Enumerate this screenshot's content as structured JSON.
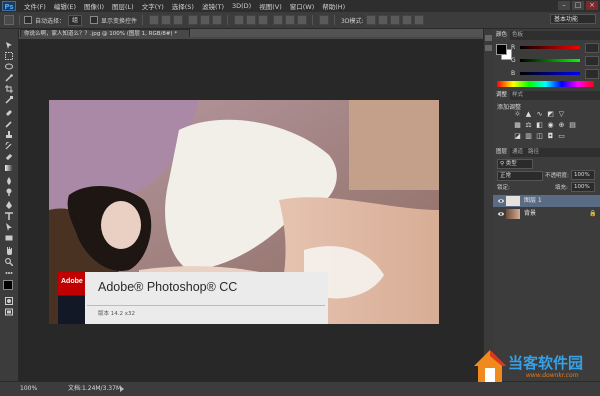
{
  "app": {
    "logo": "Ps"
  },
  "menu": [
    "文件(F)",
    "编辑(E)",
    "图像(I)",
    "图层(L)",
    "文字(Y)",
    "选择(S)",
    "滤镜(T)",
    "3D(D)",
    "视图(V)",
    "窗口(W)",
    "帮助(H)"
  ],
  "window_controls": {
    "minimize": "–",
    "restore": "□",
    "close": "×"
  },
  "options_bar": {
    "auto_select_label": "自动选择：",
    "auto_select_value": "组",
    "show_transform_label": "显示变换控件",
    "workspace": "基本功能"
  },
  "document": {
    "tab_title": "你说么啊，家人知道么？？.jpg @ 100% (图层 1, RGB/8#) *"
  },
  "splash": {
    "logo_text": "Adobe",
    "title": "Adobe® Photoshop® CC",
    "version": "版本 14.2 x32"
  },
  "status": {
    "zoom": "100%",
    "doc_info": "文档:1.24M/3.37M"
  },
  "panels": {
    "color_tabs": [
      "颜色",
      "色板"
    ],
    "sliders": [
      {
        "label": "R",
        "color": "#ff0000"
      },
      {
        "label": "G",
        "color": "#00ff00"
      },
      {
        "label": "B",
        "color": "#0000ff"
      }
    ],
    "adjust_tabs": [
      "调整",
      "样式"
    ],
    "adjust_title": "添加调整",
    "layers_tabs": [
      "图层",
      "通道",
      "路径"
    ],
    "kind_select": "类型",
    "blend_mode": "正常",
    "opacity_label": "不透明度:",
    "opacity_value": "100%",
    "lock_label": "锁定:",
    "fill_label": "填充:",
    "fill_value": "100%",
    "layers": [
      {
        "name": "图层 1",
        "selected": true
      },
      {
        "name": "背景",
        "selected": false
      }
    ]
  },
  "watermark": {
    "text": "当客软件园",
    "url": "www.downkr.com"
  },
  "colors": {
    "accent": "#35a0e8",
    "adobe_red": "#c00000",
    "layer_selected": "#5a6c84"
  }
}
